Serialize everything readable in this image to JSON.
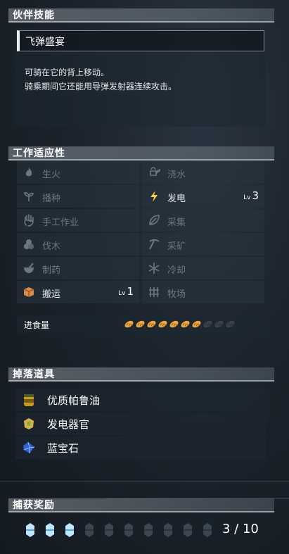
{
  "partner_skill": {
    "header": "伙伴技能",
    "name": "飞弹盛宴",
    "desc_line1": "可骑在它的背上移动。",
    "desc_line2": "骑乘期间它还能用导弹发射器连续攻击。"
  },
  "work_suitability": {
    "header": "工作适应性",
    "items": [
      {
        "label": "生火",
        "level": "",
        "active": false,
        "icon": "flame-icon"
      },
      {
        "label": "浇水",
        "level": "",
        "active": false,
        "icon": "watering-can-icon"
      },
      {
        "label": "播种",
        "level": "",
        "active": false,
        "icon": "sprout-icon"
      },
      {
        "label": "发电",
        "level": "3",
        "active": true,
        "icon": "lightning-icon"
      },
      {
        "label": "手工作业",
        "level": "",
        "active": false,
        "icon": "hand-icon"
      },
      {
        "label": "采集",
        "level": "",
        "active": false,
        "icon": "leaf-icon"
      },
      {
        "label": "伐木",
        "level": "",
        "active": false,
        "icon": "logs-icon"
      },
      {
        "label": "采矿",
        "level": "",
        "active": false,
        "icon": "pickaxe-icon"
      },
      {
        "label": "制药",
        "level": "",
        "active": false,
        "icon": "mortar-icon"
      },
      {
        "label": "冷却",
        "level": "",
        "active": false,
        "icon": "snowflake-icon"
      },
      {
        "label": "搬运",
        "level": "1",
        "active": true,
        "icon": "box-icon"
      },
      {
        "label": "牧场",
        "level": "",
        "active": false,
        "icon": "fence-icon"
      }
    ],
    "level_prefix": "Lv",
    "food_label": "进食量",
    "food_filled": 7,
    "food_total": 10
  },
  "drops": {
    "header": "掉落道具",
    "items": [
      {
        "label": "优质帕鲁油",
        "icon": "oil-jar-icon"
      },
      {
        "label": "发电器官",
        "icon": "organ-icon"
      },
      {
        "label": "蓝宝石",
        "icon": "sapphire-icon"
      }
    ]
  },
  "capture": {
    "header": "捕获奖励",
    "current": 3,
    "total": 10,
    "display": "3 / 10"
  },
  "colors": {
    "active_text": "#ffffff",
    "inactive_text": "#6d7780",
    "food_fill": "#e8a640",
    "gem_fill": "#bfe7ff"
  }
}
